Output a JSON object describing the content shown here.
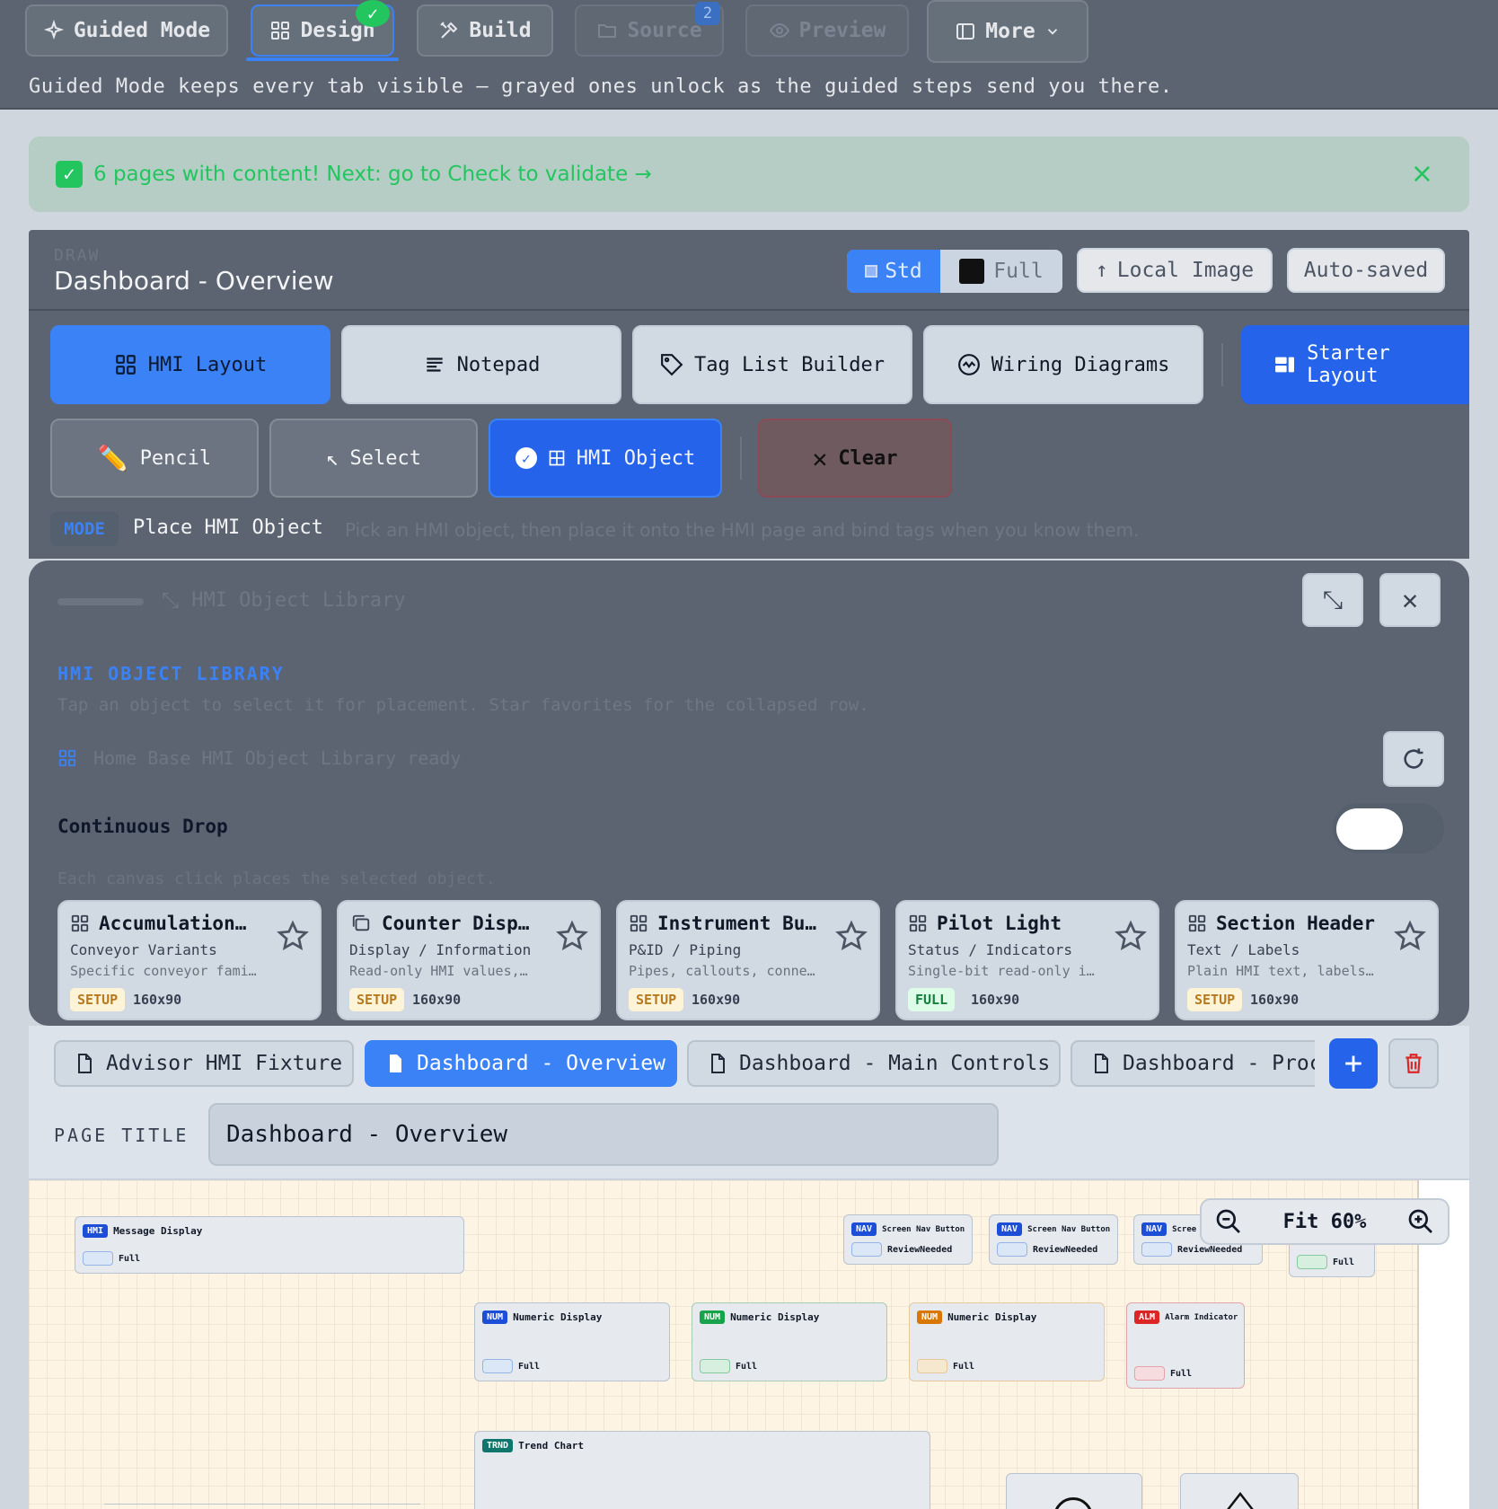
{
  "nav": {
    "tabs": [
      {
        "label": "Guided Mode"
      },
      {
        "label": "Design"
      },
      {
        "label": "Build"
      },
      {
        "label": "Source"
      },
      {
        "label": "Preview"
      },
      {
        "label": "More"
      }
    ],
    "source_count": "2",
    "design_check": "✓",
    "hint": "Guided Mode keeps every tab visible — grayed ones unlock as the guided steps send you there."
  },
  "banner": {
    "check": "✓",
    "text": "6 pages with content! Next: go to Check to validate →",
    "close": "×"
  },
  "draw": {
    "kicker": "DRAW",
    "title": "Dashboard - Overview",
    "std_label": "Std",
    "full_label": "Full",
    "local_image_label": "Local Image",
    "autosaved_label": "Auto-saved",
    "modes": [
      {
        "label": "HMI Layout"
      },
      {
        "label": "Notepad"
      },
      {
        "label": "Tag List Builder"
      },
      {
        "label": "Wiring Diagrams"
      },
      {
        "label": "Starter Layout"
      }
    ],
    "tools": [
      {
        "label": "Pencil"
      },
      {
        "label": "Select"
      },
      {
        "label": "HMI Object"
      },
      {
        "label": "Clear"
      }
    ],
    "mode_tag": "MODE",
    "mode_name": "Place HMI Object",
    "mode_desc": "Pick an HMI object, then place it onto the HMI page and bind tags when you know them."
  },
  "library": {
    "header": "HMI Object Library",
    "kicker": "HMI OBJECT LIBRARY",
    "desc": "Tap an object to select it for placement. Star favorites for the collapsed row.",
    "ready": "Home Base HMI Object Library ready",
    "continuous_label": "Continuous Drop",
    "continuous_desc": "Each canvas click places the selected object.",
    "cards": [
      {
        "title": "Accumulation…",
        "cat": "Conveyor Variants",
        "desc": "Specific conveyor fami…",
        "badge": "SETUP",
        "size": "160x90"
      },
      {
        "title": "Counter Disp…",
        "cat": "Display / Information",
        "desc": "Read-only HMI values,…",
        "badge": "SETUP",
        "size": "160x90"
      },
      {
        "title": "Instrument Bu…",
        "cat": "P&ID / Piping",
        "desc": "Pipes, callouts, conne…",
        "badge": "SETUP",
        "size": "160x90"
      },
      {
        "title": "Pilot Light",
        "cat": "Status / Indicators",
        "desc": "Single-bit read-only i…",
        "badge": "FULL",
        "size": "160x90"
      },
      {
        "title": "Section Header",
        "cat": "Text / Labels",
        "desc": "Plain HMI text, labels…",
        "badge": "SETUP",
        "size": "160x90"
      }
    ]
  },
  "pages": {
    "tabs": [
      {
        "label": "Advisor HMI Fixture"
      },
      {
        "label": "Dashboard - Overview"
      },
      {
        "label": "Dashboard - Main Controls"
      },
      {
        "label": "Dashboard - Proc"
      }
    ],
    "add": "+",
    "title_label": "PAGE TITLE",
    "title_value": "Dashboard - Overview"
  },
  "canvas": {
    "zoom_label": "Fit 60%",
    "objects": [
      {
        "tag": "HMI",
        "name": "Message Display",
        "status": "Full",
        "color": "#1d4ed8"
      },
      {
        "tag": "NAV",
        "name": "Screen Nav Button",
        "status": "ReviewNeeded",
        "color": "#1d4ed8"
      },
      {
        "tag": "NAV",
        "name": "Screen Nav Button",
        "status": "ReviewNeeded",
        "color": "#1d4ed8"
      },
      {
        "tag": "NAV",
        "name": "Scree",
        "status": "ReviewNeeded",
        "color": "#1d4ed8"
      },
      {
        "tag": "",
        "name": "",
        "status": "Full",
        "color": "#16a34a"
      },
      {
        "tag": "NUM",
        "name": "Numeric Display",
        "status": "Full",
        "color": "#1d4ed8"
      },
      {
        "tag": "NUM",
        "name": "Numeric Display",
        "status": "Full",
        "color": "#16a34a"
      },
      {
        "tag": "NUM",
        "name": "Numeric Display",
        "status": "Full",
        "color": "#d97706"
      },
      {
        "tag": "ALM",
        "name": "Alarm Indicator",
        "status": "Full",
        "color": "#dc2626"
      },
      {
        "tag": "TRND",
        "name": "Trend Chart",
        "status": "",
        "color": "#0f766e"
      }
    ]
  }
}
